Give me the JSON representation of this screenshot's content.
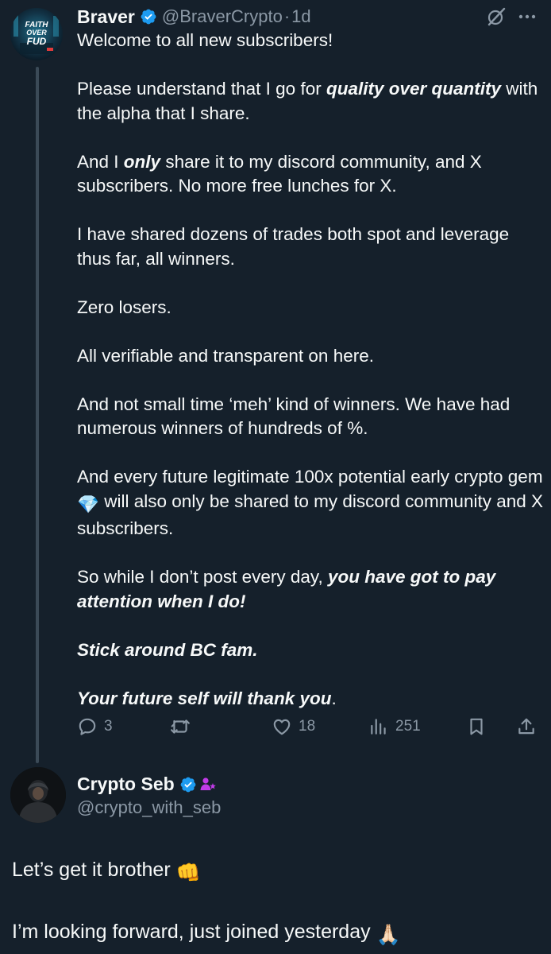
{
  "tweet": {
    "author_name": "Braver",
    "author_handle": "@BraverCrypto",
    "separator": "·",
    "time": "1d",
    "avatar_text": [
      "FAITH",
      "OVER",
      "FUD"
    ],
    "paragraphs": [
      [
        {
          "t": "Welcome to all new subscribers!",
          "s": "n"
        }
      ],
      [
        {
          "t": "Please understand that I go for ",
          "s": "n"
        },
        {
          "t": "quality over quantity",
          "s": "bi"
        },
        {
          "t": " with the alpha that I share.",
          "s": "n"
        }
      ],
      [
        {
          "t": "And I ",
          "s": "n"
        },
        {
          "t": "only",
          "s": "bi"
        },
        {
          "t": " share it to my discord community, and X subscribers. No more free lunches for X.",
          "s": "n"
        }
      ],
      [
        {
          "t": "I have shared dozens of trades both spot and leverage thus far, all winners.",
          "s": "n"
        }
      ],
      [
        {
          "t": "Zero losers.",
          "s": "n"
        }
      ],
      [
        {
          "t": "All verifiable and transparent on here.",
          "s": "n"
        }
      ],
      [
        {
          "t": "And not small time ‘meh’ kind of winners. We have had numerous winners of hundreds of %.",
          "s": "n"
        }
      ],
      [
        {
          "t": "And every future legitimate 100x potential early crypto gem ",
          "s": "n"
        },
        {
          "t": "💎",
          "s": "emoji"
        },
        {
          "t": " will also only be shared to my discord community and X subscribers.",
          "s": "n"
        }
      ],
      [
        {
          "t": "So while I don’t post every day, ",
          "s": "n"
        },
        {
          "t": "you have got to pay attention when I do!",
          "s": "bi"
        }
      ],
      [
        {
          "t": "Stick around BC fam.",
          "s": "bi"
        }
      ],
      [
        {
          "t": "Your future self will thank you",
          "s": "bi"
        },
        {
          "t": ".",
          "s": "n"
        }
      ]
    ],
    "actions": {
      "replies": "3",
      "reposts": "",
      "likes": "18",
      "views": "251"
    }
  },
  "reply": {
    "author_name": "Crypto Seb",
    "author_handle": "@crypto_with_seb",
    "lines": [
      {
        "text": "Let’s get it brother ",
        "emoji": "👊"
      },
      {
        "text": "I’m looking forward, just joined yesterday ",
        "emoji": "🙏🏻"
      }
    ]
  },
  "colors": {
    "background": "#15202b",
    "text_primary": "#f7f9f9",
    "text_secondary": "#8b98a5",
    "verified_blue": "#1d9bf0",
    "subscriber_badge": "#c13be8",
    "thread_line": "#3b4a57"
  },
  "icons": [
    "verified-icon",
    "grok-icon",
    "more-icon",
    "reply-icon",
    "repost-icon",
    "like-icon",
    "views-icon",
    "bookmark-icon",
    "share-icon",
    "subscriber-badge-icon"
  ]
}
